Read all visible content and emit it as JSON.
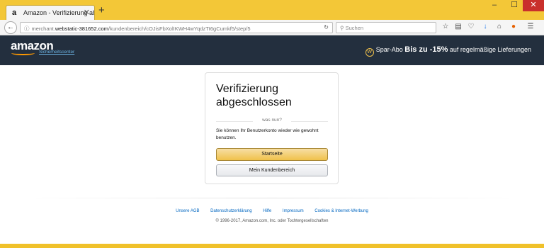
{
  "browser": {
    "tab_title": "Amazon - Verifizierung ab...",
    "tab_favicon": "a",
    "tab_close": "✕",
    "new_tab": "+",
    "win_min": "–",
    "win_max": "☐",
    "win_close": "✕",
    "url_prefix": "merchant.",
    "url_domain": "webstatic-381652.com",
    "url_path": "/kundenbereich/cOJisFbXolIKWH4wYqdzTt6gCumkf5/step/5",
    "search_placeholder": "Suchen",
    "icons": [
      "back-icon",
      "info-icon",
      "reload-icon",
      "search-icon",
      "bookmark-star-icon",
      "reading-list-icon",
      "pocket-icon",
      "download-icon",
      "home-icon",
      "firefox-account-icon",
      "menu-icon"
    ]
  },
  "header": {
    "logo": "amazon",
    "subtitle": "Sicherheitscenter",
    "promo_badge": "W",
    "promo_prefix": "Spar-Abo",
    "promo_big": "Bis zu -15%",
    "promo_suffix": "auf regelmäßige Lieferungen"
  },
  "card": {
    "title": "Verifizierung abgeschlossen",
    "divider_label": "was nun?",
    "text": "Sie können Ihr Benutzerkonto wieder wie gewohnt benutzen.",
    "primary_button": "Startseite",
    "secondary_button": "Mein Kundenbereich"
  },
  "footer": {
    "links": [
      "Unsere AGB",
      "Datenschutzerklärung",
      "Hilfe",
      "Impressum",
      "Cookies & Internet-Werbung"
    ],
    "copyright": "© 1996-2017, Amazon.com, Inc. oder Tochtergesellschaften"
  },
  "colors": {
    "header_bg": "#232f3e",
    "accent": "#f0c14b",
    "link": "#0066c0",
    "chrome": "#f3c737"
  }
}
